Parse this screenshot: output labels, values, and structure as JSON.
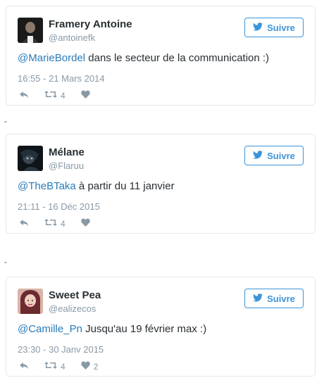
{
  "tweets": [
    {
      "name": "Framery Antoine",
      "handle": "@antoinefk",
      "follow_label": "Suivre",
      "mention": "@MarieBordel",
      "text": " dans le secteur de la communication :)",
      "time": "16:55 - 21 Mars 2014",
      "retweets": "4",
      "likes": ""
    },
    {
      "name": "Mélane",
      "handle": "@Flaruu",
      "follow_label": "Suivre",
      "mention": "@TheBTaka",
      "text": " à partir du 11 janvier",
      "time": "21:11 - 16 Déc 2015",
      "retweets": "4",
      "likes": ""
    },
    {
      "name": "Sweet Pea",
      "handle": "@ealizecos",
      "follow_label": "Suivre",
      "mention": "@Camille_Pn",
      "text": " Jusqu'au 19 février max :)",
      "time": "23:30 - 30 Janv 2015",
      "retweets": "4",
      "likes": "2"
    }
  ],
  "separators": [
    "-",
    "-"
  ],
  "colors": {
    "accent": "#3b94d9",
    "link": "#2b7bb9",
    "muted": "#8899a6",
    "text": "#292f33",
    "border": "#e1e8ed"
  },
  "icons": [
    "twitter-bird-icon",
    "reply-icon",
    "retweet-icon",
    "heart-icon"
  ]
}
